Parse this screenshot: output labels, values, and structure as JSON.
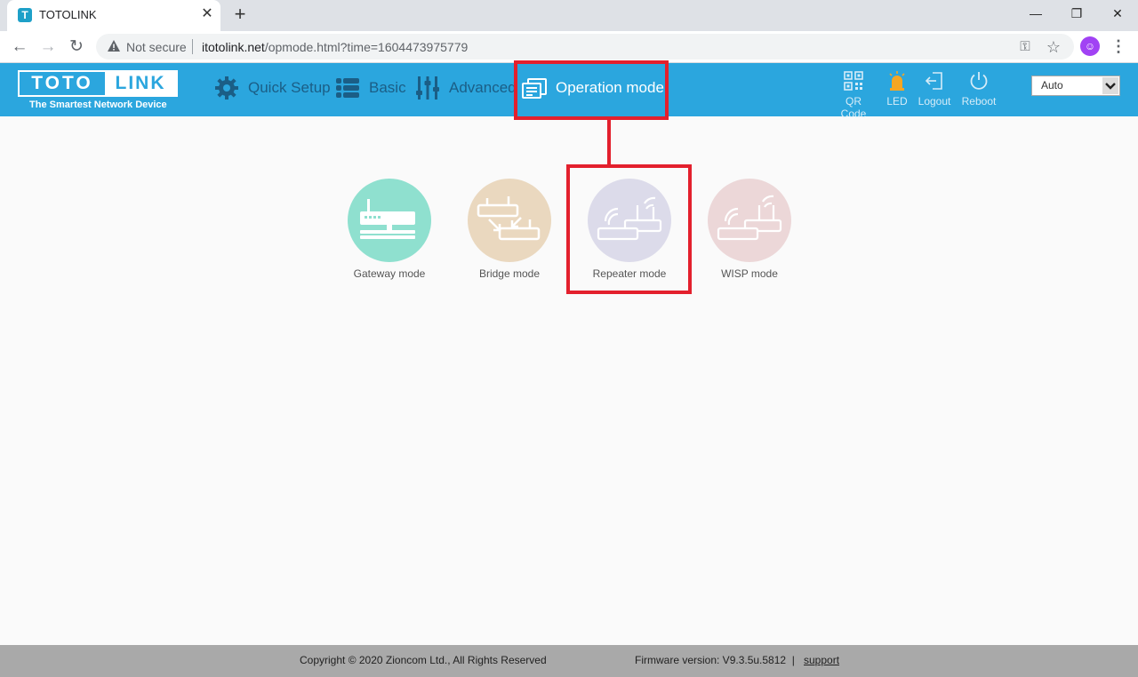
{
  "browser": {
    "tab_title": "TOTOLINK",
    "tab_favicon_letter": "T",
    "tab_close": "✕",
    "new_tab": "+",
    "window_controls": {
      "minimize": "—",
      "restore": "❐",
      "close": "✕"
    },
    "nav": {
      "back": "←",
      "forward": "→",
      "reload": "↻"
    },
    "security_label": "Not secure",
    "url_host": "itotolink.net",
    "url_path": "/opmode.html?time=1604473975779",
    "key_icon": "⚿",
    "star_icon": "☆",
    "menu_icon": "⋮"
  },
  "router": {
    "logo": {
      "left": "TOTO",
      "right": "LINK",
      "tagline": "The Smartest Network Device"
    },
    "nav": [
      {
        "label": "Quick Setup",
        "icon": "gear-icon"
      },
      {
        "label": "Basic",
        "icon": "list-icon"
      },
      {
        "label": "Advanced",
        "icon": "sliders-icon"
      },
      {
        "label": "Operation mode",
        "icon": "operation-mode-icon",
        "active": true
      }
    ],
    "tools": [
      {
        "label": "QR Code",
        "icon": "qr-code-icon"
      },
      {
        "label": "LED",
        "icon": "led-icon"
      },
      {
        "label": "Logout",
        "icon": "logout-icon"
      },
      {
        "label": "Reboot",
        "icon": "power-icon"
      }
    ],
    "language": {
      "selected": "Auto"
    }
  },
  "modes": [
    {
      "label": "Gateway mode",
      "color": "#8fe0cf"
    },
    {
      "label": "Bridge mode",
      "color": "#ead8bf"
    },
    {
      "label": "Repeater mode",
      "color": "#dcdbea",
      "highlighted": true
    },
    {
      "label": "WISP mode",
      "color": "#ecd7d8"
    }
  ],
  "colors": {
    "header": "#2ba6de",
    "highlight": "#e3202d",
    "footer": "#a9a9a9"
  },
  "footer": {
    "copyright": "Copyright © 2020 Zioncom Ltd., All Rights Reserved",
    "firmware": "Firmware version: V9.3.5u.5812  |",
    "support": "support"
  }
}
